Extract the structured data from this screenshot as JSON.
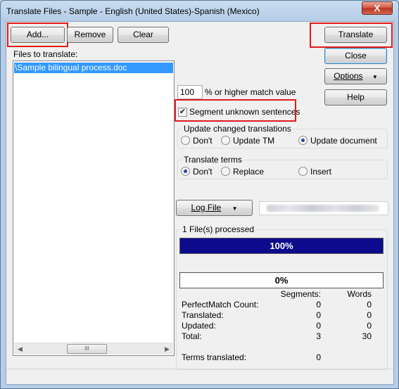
{
  "window": {
    "title": "Translate Files - Sample - English (United States)-Spanish (Mexico)",
    "close_glyph": "X"
  },
  "toolbar": {
    "add_label": "Add...",
    "remove_label": "Remove",
    "clear_label": "Clear"
  },
  "files": {
    "heading": "Files to translate:",
    "items": [
      "\\Sample bilingual process.doc"
    ],
    "scroll_thumb_glyph": "III"
  },
  "actions": {
    "translate_label": "Translate",
    "close_label": "Close",
    "options_label": "Options",
    "help_label": "Help"
  },
  "match": {
    "value": "100",
    "suffix": "%  or higher match value"
  },
  "segment_unknown": {
    "label": "Segment unknown sentences",
    "checked": true
  },
  "update_group": {
    "title": "Update changed translations",
    "options": [
      "Don't",
      "Update TM",
      "Update document"
    ],
    "selected": "Update document"
  },
  "terms_group": {
    "title": "Translate terms",
    "options": [
      "Don't",
      "Replace",
      "Insert"
    ],
    "selected": "Don't"
  },
  "log": {
    "button_label": "Log File"
  },
  "progress": {
    "title": "1 File(s) processed",
    "overall_percent": "100%",
    "overall_fraction": 1.0,
    "current_percent": "0%",
    "current_fraction": 0.0
  },
  "stats": {
    "col_segments": "Segments:",
    "col_words": "Words",
    "rows": [
      {
        "label": "PerfectMatch Count:",
        "segments": "0",
        "words": "0"
      },
      {
        "label": "Translated:",
        "segments": "0",
        "words": "0"
      },
      {
        "label": "Updated:",
        "segments": "0",
        "words": "0"
      },
      {
        "label": "Total:",
        "segments": "3",
        "words": "30"
      }
    ],
    "terms_label": "Terms translated:",
    "terms_value": "0"
  },
  "colors": {
    "highlight_box": "#e21b1b",
    "progress_fill": "#0d0b8c",
    "selection": "#3399ff"
  }
}
